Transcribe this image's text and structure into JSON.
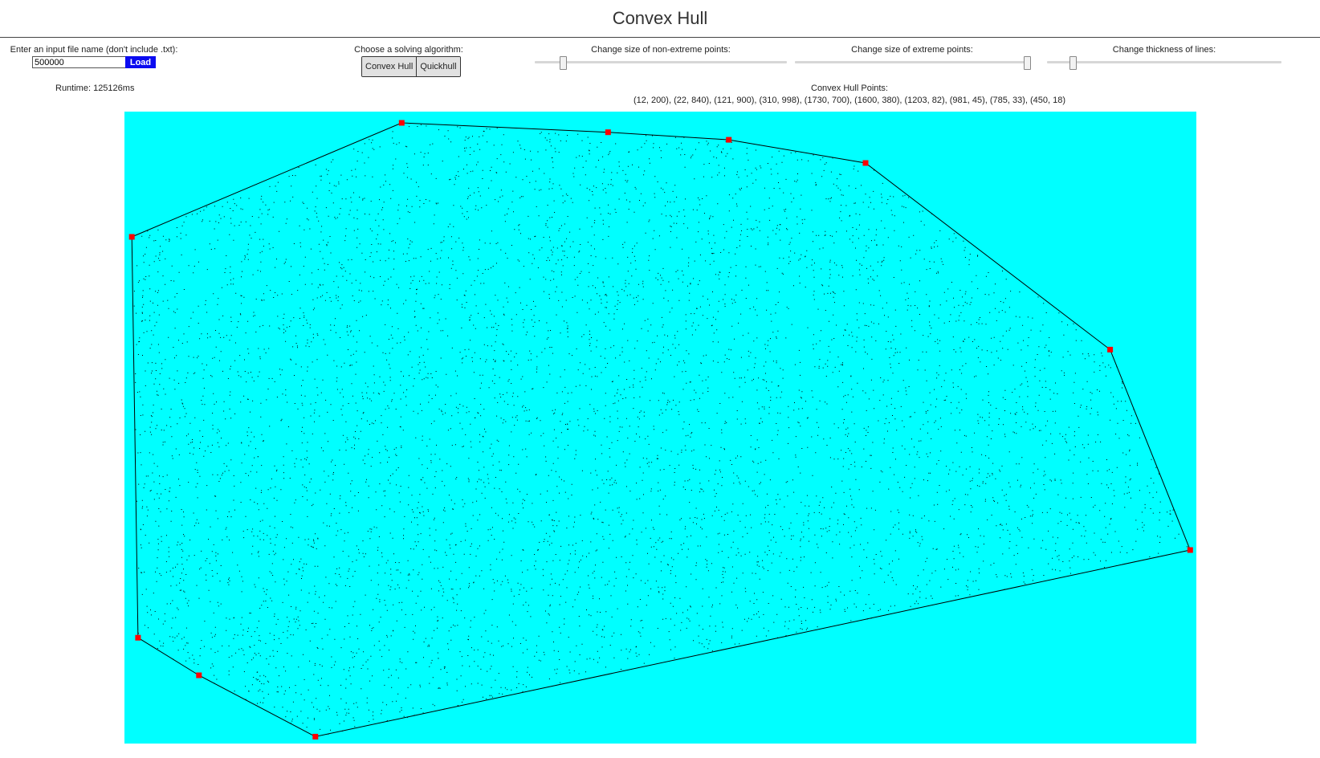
{
  "app": {
    "title": "Convex Hull"
  },
  "file": {
    "label": "Enter an input file name (don't include .txt):",
    "value": "500000",
    "load_label": "Load"
  },
  "algorithm": {
    "label": "Choose a solving algorithm:",
    "options": [
      "Convex Hull",
      "Quickhull"
    ]
  },
  "sliders": {
    "non_extreme": {
      "label": "Change size of non-extreme points:",
      "level": 0.11
    },
    "extreme": {
      "label": "Change size of extreme points:",
      "level": 0.99
    },
    "thickness": {
      "label": "Change thickness of lines:",
      "level": 0.11
    }
  },
  "runtime": {
    "text": "Runtime: 125126ms"
  },
  "hull": {
    "label": "Convex Hull Points:",
    "points_text": "(12, 200), (22, 840), (121, 900), (310, 998), (1730, 700), (1600, 380), (1203, 82), (981, 45), (785, 33), (450, 18)"
  },
  "colors": {
    "canvas_bg": "#00ffff",
    "scatter_points": "#000000",
    "hull_line": "#000000",
    "extreme_points": "#ff0000",
    "load_button": "#0b0bf0"
  }
}
